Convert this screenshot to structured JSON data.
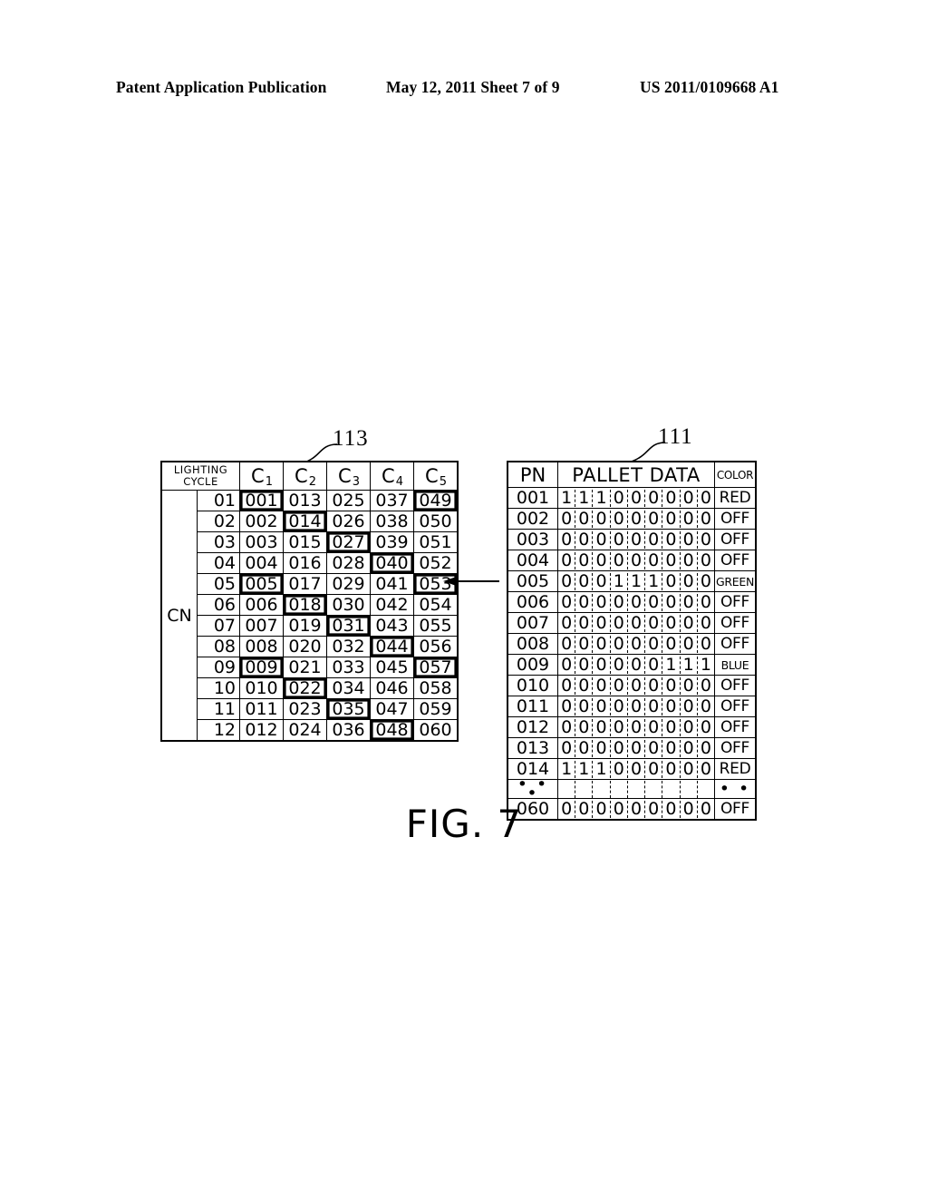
{
  "header": {
    "left": "Patent Application Publication",
    "middle": "May 12, 2011  Sheet 7 of 9",
    "right": "US 2011/0109668 A1"
  },
  "figure": {
    "caption": "FIG. 7"
  },
  "refs": {
    "left_table": "113",
    "right_table": "111"
  },
  "left_table": {
    "corner_header": "LIGHTING\nCYCLE",
    "corner_header_line1": "LIGHTING",
    "corner_header_line2": "CYCLE",
    "row_group_label": "CN",
    "column_headers": [
      {
        "base": "C",
        "sub": "1"
      },
      {
        "base": "C",
        "sub": "2"
      },
      {
        "base": "C",
        "sub": "3"
      },
      {
        "base": "C",
        "sub": "4"
      },
      {
        "base": "C",
        "sub": "5"
      }
    ],
    "rows": [
      {
        "cycle": "01",
        "cells": [
          "001",
          "013",
          "025",
          "037",
          "049"
        ],
        "bold": [
          true,
          false,
          false,
          false,
          true
        ]
      },
      {
        "cycle": "02",
        "cells": [
          "002",
          "014",
          "026",
          "038",
          "050"
        ],
        "bold": [
          false,
          true,
          false,
          false,
          false
        ]
      },
      {
        "cycle": "03",
        "cells": [
          "003",
          "015",
          "027",
          "039",
          "051"
        ],
        "bold": [
          false,
          false,
          true,
          false,
          false
        ]
      },
      {
        "cycle": "04",
        "cells": [
          "004",
          "016",
          "028",
          "040",
          "052"
        ],
        "bold": [
          false,
          false,
          false,
          true,
          false
        ]
      },
      {
        "cycle": "05",
        "cells": [
          "005",
          "017",
          "029",
          "041",
          "053"
        ],
        "bold": [
          true,
          false,
          false,
          false,
          true
        ]
      },
      {
        "cycle": "06",
        "cells": [
          "006",
          "018",
          "030",
          "042",
          "054"
        ],
        "bold": [
          false,
          true,
          false,
          false,
          false
        ]
      },
      {
        "cycle": "07",
        "cells": [
          "007",
          "019",
          "031",
          "043",
          "055"
        ],
        "bold": [
          false,
          false,
          true,
          false,
          false
        ]
      },
      {
        "cycle": "08",
        "cells": [
          "008",
          "020",
          "032",
          "044",
          "056"
        ],
        "bold": [
          false,
          false,
          false,
          true,
          false
        ]
      },
      {
        "cycle": "09",
        "cells": [
          "009",
          "021",
          "033",
          "045",
          "057"
        ],
        "bold": [
          true,
          false,
          false,
          false,
          true
        ]
      },
      {
        "cycle": "10",
        "cells": [
          "010",
          "022",
          "034",
          "046",
          "058"
        ],
        "bold": [
          false,
          true,
          false,
          false,
          false
        ]
      },
      {
        "cycle": "11",
        "cells": [
          "011",
          "023",
          "035",
          "047",
          "059"
        ],
        "bold": [
          false,
          false,
          true,
          false,
          false
        ]
      },
      {
        "cycle": "12",
        "cells": [
          "012",
          "024",
          "036",
          "048",
          "060"
        ],
        "bold": [
          false,
          false,
          false,
          true,
          false
        ]
      }
    ]
  },
  "right_table": {
    "headers": {
      "pn": "PN",
      "pallet_data": "PALLET DATA",
      "color": "COLOR"
    },
    "rows": [
      {
        "pn": "001",
        "bits": [
          "1",
          "1",
          "1",
          "0",
          "0",
          "0",
          "0",
          "0",
          "0"
        ],
        "color": "RED",
        "small": false
      },
      {
        "pn": "002",
        "bits": [
          "0",
          "0",
          "0",
          "0",
          "0",
          "0",
          "0",
          "0",
          "0"
        ],
        "color": "OFF",
        "small": false
      },
      {
        "pn": "003",
        "bits": [
          "0",
          "0",
          "0",
          "0",
          "0",
          "0",
          "0",
          "0",
          "0"
        ],
        "color": "OFF",
        "small": false
      },
      {
        "pn": "004",
        "bits": [
          "0",
          "0",
          "0",
          "0",
          "0",
          "0",
          "0",
          "0",
          "0"
        ],
        "color": "OFF",
        "small": false
      },
      {
        "pn": "005",
        "bits": [
          "0",
          "0",
          "0",
          "1",
          "1",
          "1",
          "0",
          "0",
          "0"
        ],
        "color": "GREEN",
        "small": true
      },
      {
        "pn": "006",
        "bits": [
          "0",
          "0",
          "0",
          "0",
          "0",
          "0",
          "0",
          "0",
          "0"
        ],
        "color": "OFF",
        "small": false
      },
      {
        "pn": "007",
        "bits": [
          "0",
          "0",
          "0",
          "0",
          "0",
          "0",
          "0",
          "0",
          "0"
        ],
        "color": "OFF",
        "small": false
      },
      {
        "pn": "008",
        "bits": [
          "0",
          "0",
          "0",
          "0",
          "0",
          "0",
          "0",
          "0",
          "0"
        ],
        "color": "OFF",
        "small": false
      },
      {
        "pn": "009",
        "bits": [
          "0",
          "0",
          "0",
          "0",
          "0",
          "0",
          "1",
          "1",
          "1"
        ],
        "color": "BLUE",
        "small": true
      },
      {
        "pn": "010",
        "bits": [
          "0",
          "0",
          "0",
          "0",
          "0",
          "0",
          "0",
          "0",
          "0"
        ],
        "color": "OFF",
        "small": false
      },
      {
        "pn": "011",
        "bits": [
          "0",
          "0",
          "0",
          "0",
          "0",
          "0",
          "0",
          "0",
          "0"
        ],
        "color": "OFF",
        "small": false
      },
      {
        "pn": "012",
        "bits": [
          "0",
          "0",
          "0",
          "0",
          "0",
          "0",
          "0",
          "0",
          "0"
        ],
        "color": "OFF",
        "small": false
      },
      {
        "pn": "013",
        "bits": [
          "0",
          "0",
          "0",
          "0",
          "0",
          "0",
          "0",
          "0",
          "0"
        ],
        "color": "OFF",
        "small": false
      },
      {
        "pn": "014",
        "bits": [
          "1",
          "1",
          "1",
          "0",
          "0",
          "0",
          "0",
          "0",
          "0"
        ],
        "color": "RED",
        "small": false
      },
      {
        "pn": "• • •",
        "bits": [
          "",
          "",
          "",
          "",
          "",
          "",
          "",
          "",
          ""
        ],
        "color": "• •",
        "small": false
      },
      {
        "pn": "060",
        "bits": [
          "0",
          "0",
          "0",
          "0",
          "0",
          "0",
          "0",
          "0",
          "0"
        ],
        "color": "OFF",
        "small": false
      }
    ]
  }
}
